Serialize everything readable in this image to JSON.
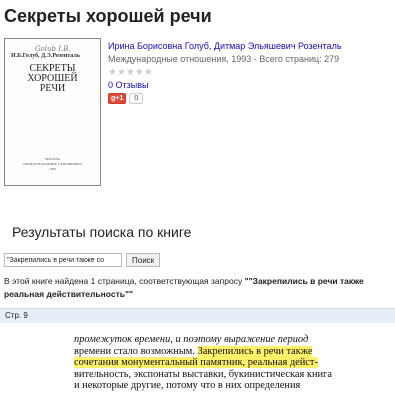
{
  "book": {
    "title": "Секреты хорошей речи",
    "authors": "Ирина Борисовна Голуб, Дитмар Эльяшевич Розенталь",
    "publication": "Международные отношения, 1993 - Всего страниц: 279",
    "rating_stars": "★★★★★",
    "reviews": "0 Отзывы",
    "gplus_label": "g+1",
    "gplus_count": "0"
  },
  "cover": {
    "signature": "Golub I.B.",
    "authors": "И.Б.Голуб, Д.Э.Розенталь",
    "title_line1": "СЕКРЕТЫ",
    "title_line2": "ХОРОШЕЙ",
    "title_line3": "РЕЧИ",
    "publisher_line1": "МОСКВА",
    "publisher_line2": "«МЕЖДУНАРОДНЫЕ ОТНОШЕНИЯ»",
    "publisher_line3": "1993"
  },
  "search": {
    "heading": "Результаты поиска по книге",
    "query_value": "\"Закрепились в речи также со",
    "button_label": "Поиск",
    "result_prefix": "В этой книге найдена 1 страница, соответствующая запросу ",
    "result_query_bold": "\"\"Закрепились в речи также реальная действительность\"\"",
    "page_label": "Стр. 9"
  },
  "snippet": {
    "line1": "промежуток времени, и поэтому выражение период",
    "line2_normal": "времени стало возможным. ",
    "line2_hl": "Закрепились в речи также",
    "line3_hl": "сочетания монументальный памятник, реальная дейст-",
    "line4": "вительность, экспонаты выставки, букинистическая книга",
    "line5": "и некоторые другие, потому что в них определения"
  }
}
